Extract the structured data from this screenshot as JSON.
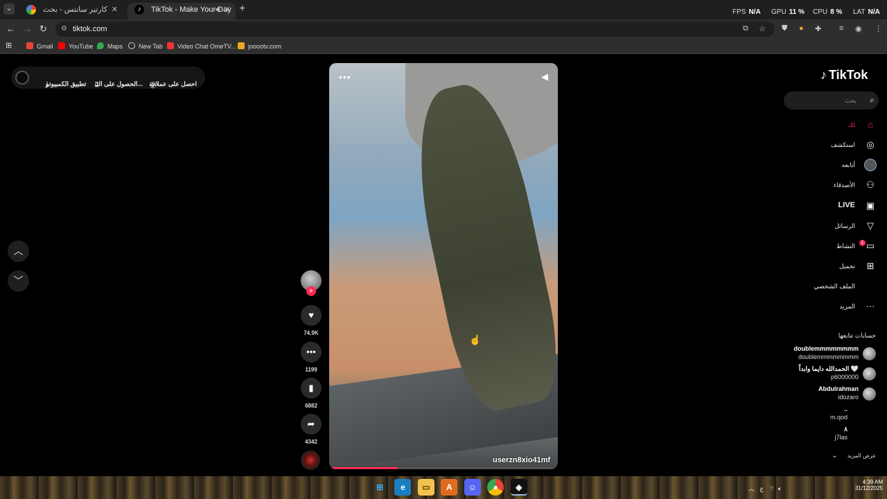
{
  "browser": {
    "tabs": [
      {
        "title": "كارتير سانتس - بحث Google",
        "favicon": "google-icon"
      },
      {
        "title": "TikTok - Make Your Day",
        "favicon": "tiktok-icon",
        "active": true
      }
    ],
    "hud": {
      "fps_label": "FPS",
      "fps_value": "N/A",
      "gpu_label": "GPU",
      "gpu_value": "11 %",
      "cpu_label": "CPU",
      "cpu_value": "8 %",
      "lat_label": "LAT",
      "lat_value": "N/A"
    },
    "url": "tiktok.com",
    "bookmarks": [
      "Gmail",
      "YouTube",
      "Maps",
      "New Tab",
      "Video Chat OmeTV...",
      "jooootv.com"
    ]
  },
  "topbar": {
    "get_coins": "احصل على عملات",
    "get_app": "الحصول على التـ...",
    "pc_app": "تطبيق الكمبيوتر"
  },
  "video": {
    "handle": "userzn8xio41mf",
    "progress": 0.3
  },
  "actions": {
    "likes": "74.9K",
    "comments": "1199",
    "saves": "6882",
    "shares": "4342"
  },
  "sidebar": {
    "logo": "TikTok",
    "search_placeholder": "بحث",
    "nav": [
      {
        "label": "لك",
        "icon": "home-icon"
      },
      {
        "label": "استكشف",
        "icon": "compass-icon"
      },
      {
        "label": "أتابعه",
        "icon": "following-avatar-icon"
      },
      {
        "label": "الأصدقاء",
        "icon": "friends-icon"
      },
      {
        "label": "LIVE",
        "icon": "live-icon"
      },
      {
        "label": "الرسائل",
        "icon": "messages-icon"
      },
      {
        "label": "النشاط",
        "icon": "activity-icon",
        "badge": "1"
      },
      {
        "label": "تحميل",
        "icon": "upload-icon"
      },
      {
        "label": "الملف الشخصي",
        "icon": "profile-icon"
      },
      {
        "label": "المزيد",
        "icon": "more-icon"
      }
    ],
    "following_heading": "حسابات تتابعها",
    "accounts": [
      {
        "name": "doublemmmmmmmm",
        "uid": "doublemmmmmmmm"
      },
      {
        "name": "الحمدالله دايما وابداً 🤍",
        "uid": "p6000000"
      },
      {
        "name": "Abdulrahman",
        "uid": "idozaro"
      },
      {
        "name": "..",
        "uid": "m.qod"
      },
      {
        "name": "٨",
        "uid": "j7las"
      }
    ],
    "see_more": "عرض المزيد"
  },
  "taskbar": {
    "time": "4:39 AM",
    "date": "31/12/2025",
    "lang": "ع"
  }
}
